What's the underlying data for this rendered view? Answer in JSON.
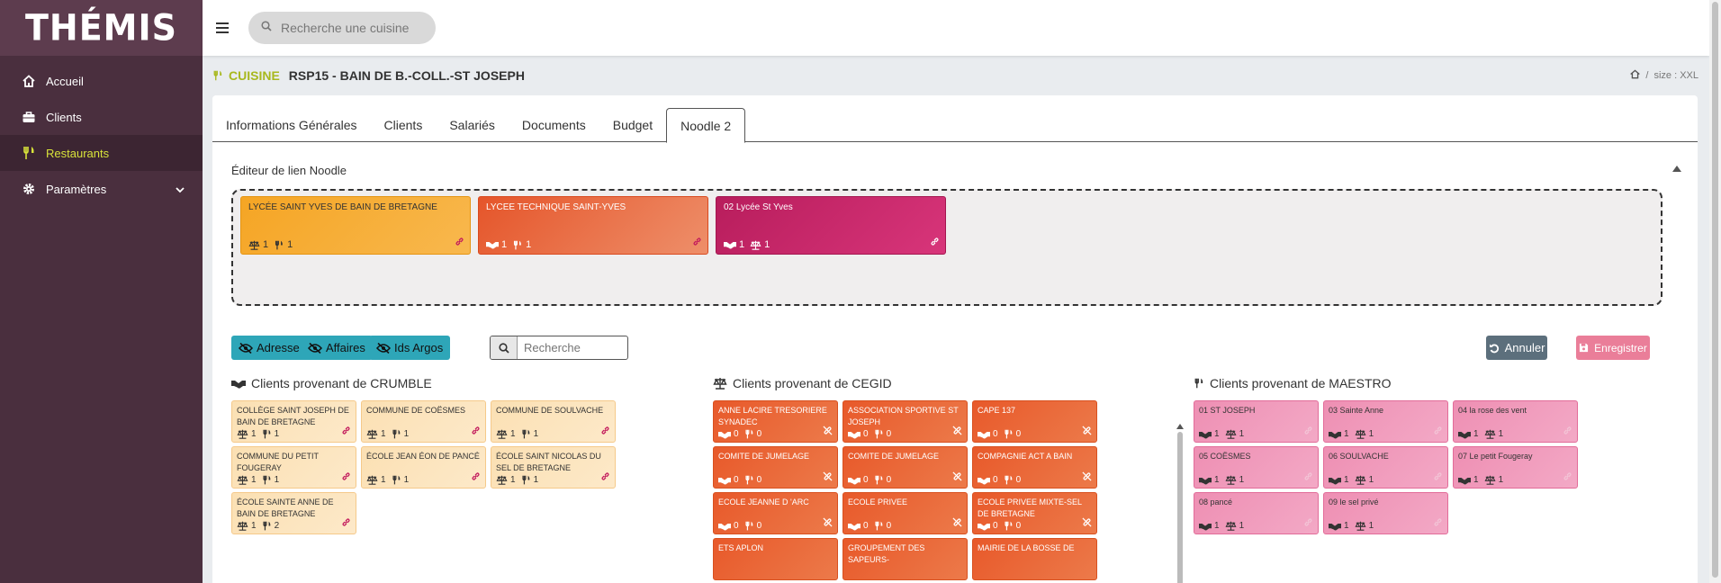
{
  "app": {
    "logo": "THÉMIS"
  },
  "search": {
    "placeholder": "Recherche une cuisine"
  },
  "sidebar": {
    "items": [
      {
        "label": "Accueil"
      },
      {
        "label": "Clients"
      },
      {
        "label": "Restaurants"
      },
      {
        "label": "Paramètres"
      }
    ]
  },
  "header": {
    "kind": "CUISINE",
    "title": "RSP15 - BAIN DE B.-COLL.-ST JOSEPH",
    "breadcrumb": "size : XXL"
  },
  "tabs": [
    "Informations Générales",
    "Clients",
    "Salariés",
    "Documents",
    "Budget",
    "Noodle 2"
  ],
  "editor": {
    "title": "Éditeur de lien Noodle"
  },
  "linked": [
    {
      "name": "LYCÉE SAINT YVES DE BAIN DE BRETAGNE",
      "c1": "1",
      "c2": "1"
    },
    {
      "name": "LYCEE TECHNIQUE SAINT-YVES",
      "c1": "1",
      "c2": "1"
    },
    {
      "name": "02 Lycée St Yves",
      "c1": "1",
      "c2": "1"
    }
  ],
  "filters": {
    "adresse": "Adresse",
    "affaires": "Affaires",
    "ids": "Ids Argos",
    "search_placeholder": "Recherche",
    "cancel": "Annuler",
    "save": "Enregistrer"
  },
  "sections": {
    "crumble": {
      "title": "Clients provenant de CRUMBLE",
      "items": [
        {
          "name": "COLLÈGE SAINT JOSEPH DE BAIN DE BRETAGNE",
          "c1": "1",
          "c2": "1"
        },
        {
          "name": "COMMUNE DE COËSMES",
          "c1": "1",
          "c2": "1"
        },
        {
          "name": "COMMUNE DE SOULVACHE",
          "c1": "1",
          "c2": "1"
        },
        {
          "name": "COMMUNE DU PETIT FOUGERAY",
          "c1": "1",
          "c2": "1"
        },
        {
          "name": "ÉCOLE JEAN ÉON DE PANCÉ",
          "c1": "1",
          "c2": "1"
        },
        {
          "name": "ÉCOLE SAINT NICOLAS DU SEL DE BRETAGNE",
          "c1": "1",
          "c2": "1"
        },
        {
          "name": "ÉCOLE SAINTE ANNE DE BAIN DE BRETAGNE",
          "c1": "1",
          "c2": "2"
        }
      ]
    },
    "cegid": {
      "title": "Clients provenant de CEGID",
      "items": [
        {
          "name": "ANNE LACIRE TRESORIERE SYNADEC",
          "c1": "0",
          "c2": "0"
        },
        {
          "name": "ASSOCIATION SPORTIVE ST JOSEPH",
          "c1": "0",
          "c2": "0"
        },
        {
          "name": "CAPE 137",
          "c1": "0",
          "c2": "0"
        },
        {
          "name": "COMITE DE JUMELAGE",
          "c1": "0",
          "c2": "0"
        },
        {
          "name": "COMITE DE JUMELAGE",
          "c1": "0",
          "c2": "0"
        },
        {
          "name": "COMPAGNIE ACT A BAIN",
          "c1": "0",
          "c2": "0"
        },
        {
          "name": "ECOLE JEANNE D 'ARC",
          "c1": "0",
          "c2": "0"
        },
        {
          "name": "ECOLE PRIVEE",
          "c1": "0",
          "c2": "0"
        },
        {
          "name": "ECOLE PRIVEE MIXTE-SEL DE BRETAGNE",
          "c1": "0",
          "c2": "0"
        },
        {
          "name": "ETS APLON",
          "c1": "",
          "c2": ""
        },
        {
          "name": "GROUPEMENT DES SAPEURS-",
          "c1": "",
          "c2": ""
        },
        {
          "name": "MAIRIE DE LA BOSSE DE",
          "c1": "",
          "c2": ""
        }
      ]
    },
    "maestro": {
      "title": "Clients provenant de MAESTRO",
      "items": [
        {
          "name": "01 ST JOSEPH",
          "c1": "1",
          "c2": "1"
        },
        {
          "name": "03 Sainte Anne",
          "c1": "1",
          "c2": "1"
        },
        {
          "name": "04 la rose des vent",
          "c1": "1",
          "c2": "1"
        },
        {
          "name": "05 COËSMES",
          "c1": "1",
          "c2": "1"
        },
        {
          "name": "06 SOULVACHE",
          "c1": "1",
          "c2": "1"
        },
        {
          "name": "07 Le petit Fougeray",
          "c1": "1",
          "c2": "1"
        },
        {
          "name": "08 pancé",
          "c1": "1",
          "c2": "1"
        },
        {
          "name": "09 le sel privé",
          "c1": "1",
          "c2": "1"
        }
      ]
    }
  },
  "colors": {
    "sidebar": "#4a2f3e",
    "accent": "#a8b81e",
    "cyan": "#2ea6b8",
    "crumble": "#fbe0b3",
    "cegid": "#e8592a",
    "maestro": "#ee8fb3"
  }
}
